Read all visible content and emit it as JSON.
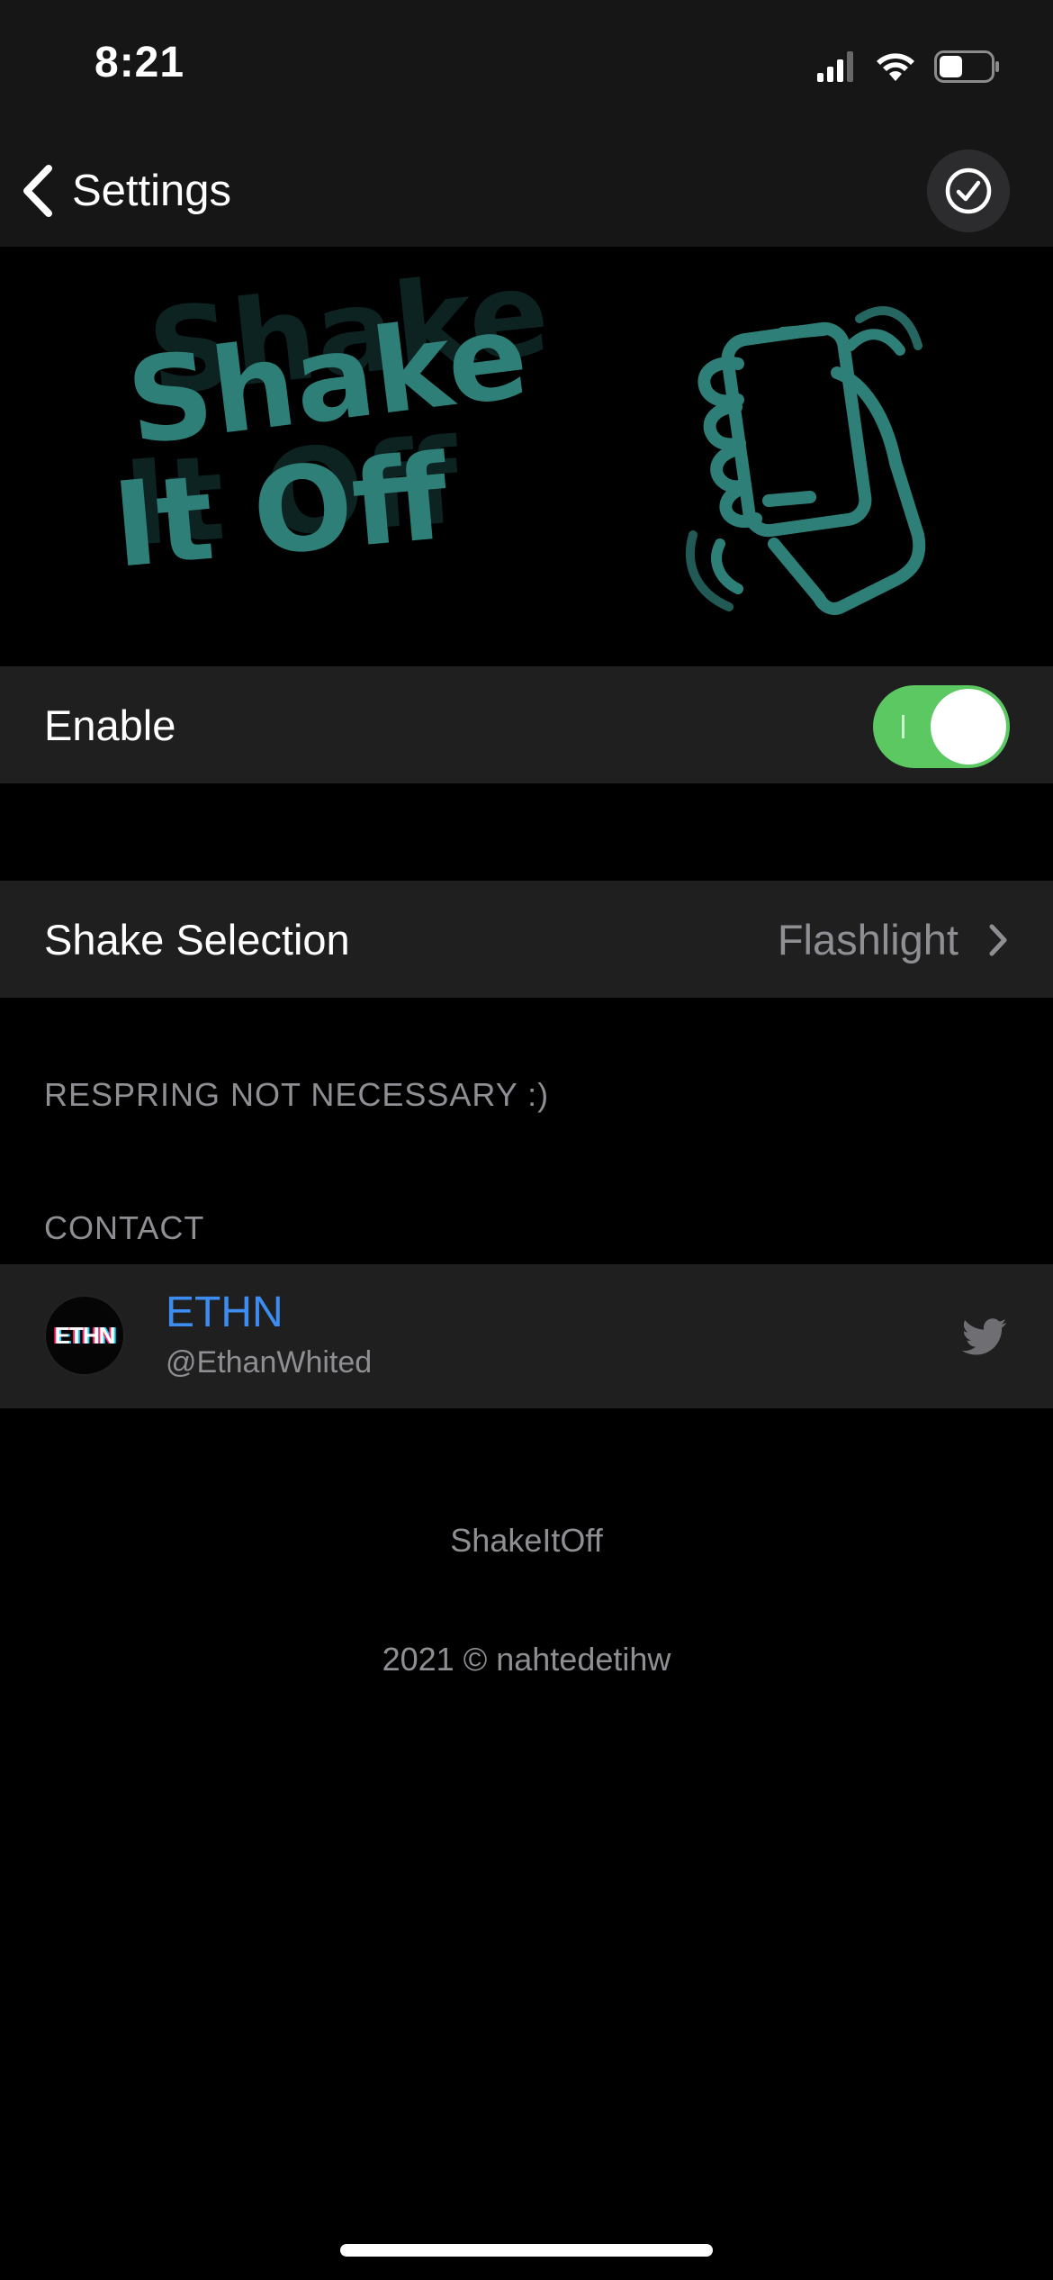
{
  "status_bar": {
    "time": "8:21",
    "battery_level": 0.45
  },
  "nav": {
    "back_label": "Settings"
  },
  "banner": {
    "logo_text_line1": "Shake",
    "logo_text_line2": "It Off",
    "accent": "#2f7f79"
  },
  "enable": {
    "label": "Enable",
    "on": true
  },
  "shake_selection": {
    "label": "Shake Selection",
    "value": "Flashlight"
  },
  "respring_note": "RESPRING NOT NECESSARY :)",
  "contact": {
    "header": "CONTACT",
    "avatar_text": "ETHN",
    "name": "ETHN",
    "handle": "@EthanWhited",
    "icon": "twitter-icon"
  },
  "footer": {
    "app_name": "ShakeItOff",
    "copyright": "2021 © nahtedetihw"
  },
  "colors": {
    "toggle_on": "#5bc862",
    "link_blue": "#3d8cf0",
    "secondary_text": "#8e8e93",
    "cell_bg": "#1f1f1f"
  }
}
